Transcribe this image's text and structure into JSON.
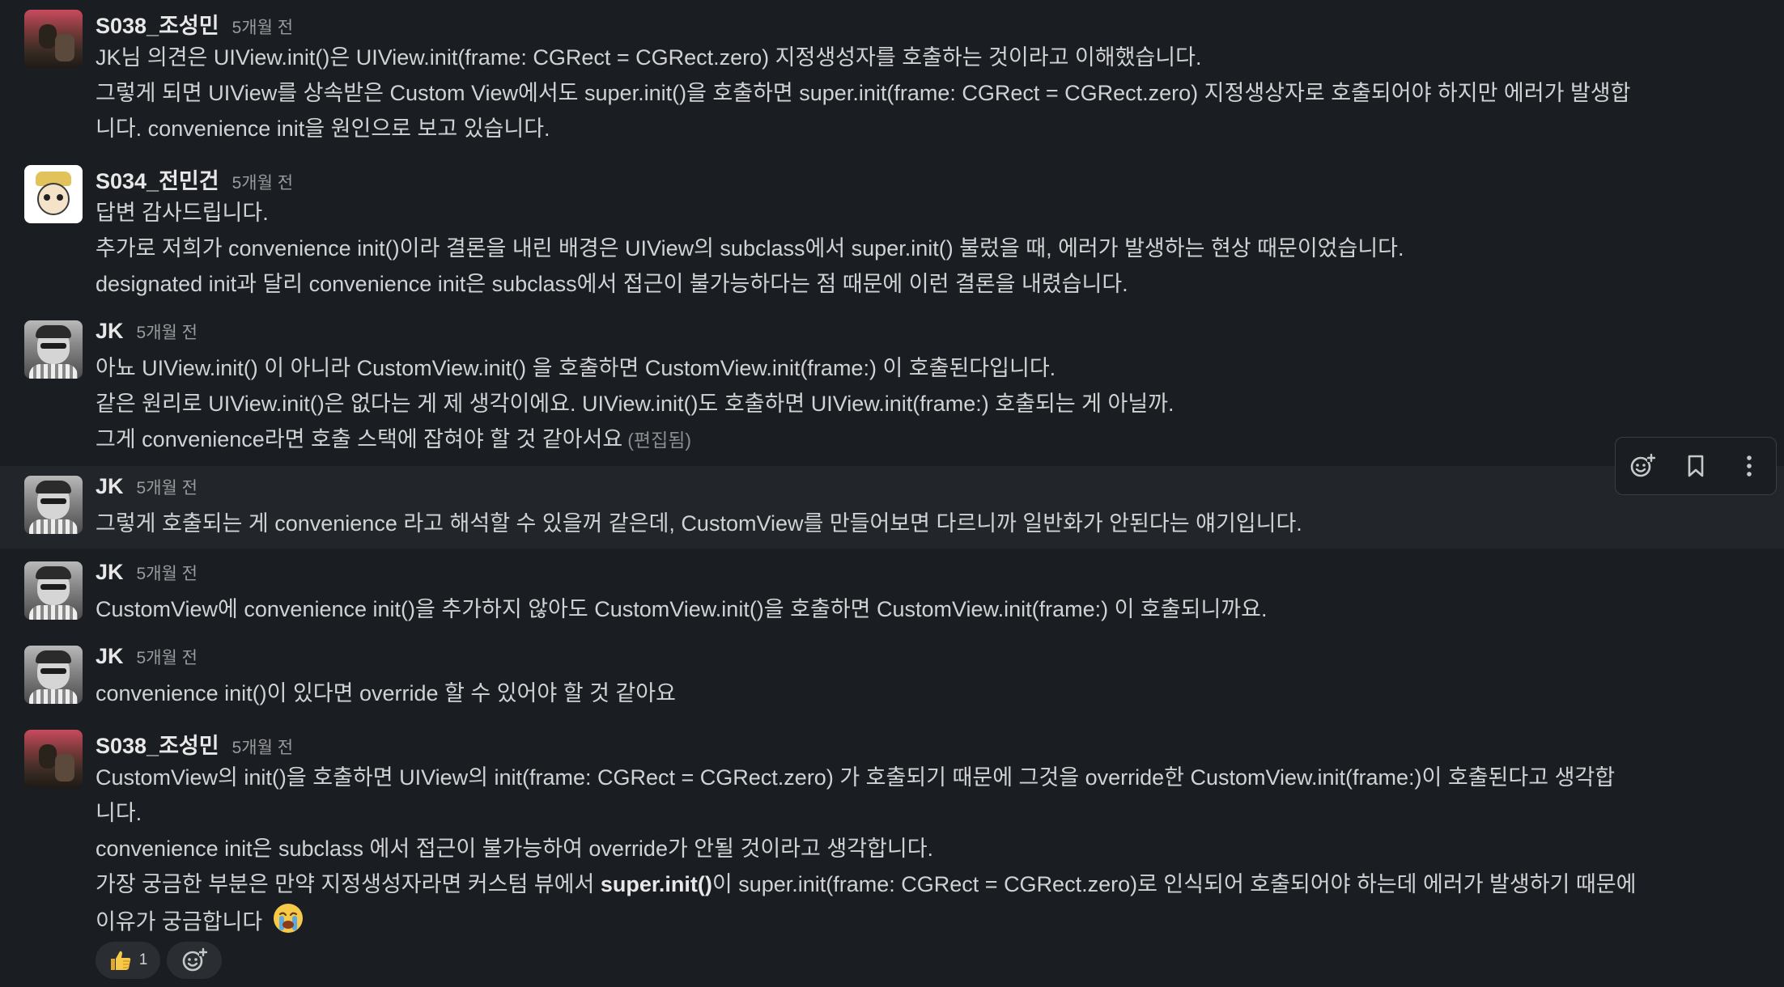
{
  "messages": [
    {
      "author": "S038_조성민",
      "time": "5개월 전",
      "lines": [
        "JK님 의견은 UIView.init()은 UIView.init(frame: CGRect = CGRect.zero) 지정생성자를 호출하는 것이라고 이해했습니다.",
        "그렇게 되면 UIView를 상속받은 Custom View에서도 super.init()을 호출하면 super.init(frame: CGRect = CGRect.zero) 지정생상자로 호출되어야 하지만 에러가 발생합",
        "니다. convenience init을 원인으로 보고 있습니다."
      ]
    },
    {
      "author": "S034_전민건",
      "time": "5개월 전",
      "lines": [
        "답변 감사드립니다.",
        "추가로 저희가 convenience init()이라 결론을 내린 배경은 UIView의 subclass에서 super.init() 불렀을 때, 에러가 발생하는 현상 때문이었습니다.",
        "designated init과 달리 convenience init은 subclass에서 접근이 불가능하다는 점 때문에 이런 결론을 내렸습니다."
      ]
    },
    {
      "author": "JK",
      "time": "5개월 전",
      "lines": [
        "아뇨 UIView.init() 이 아니라 CustomView.init() 을 호출하면 CustomView.init(frame:) 이 호출된다입니다.",
        "같은 원리로 UIView.init()은 없다는 게 제 생각이에요. UIView.init()도 호출하면 UIView.init(frame:) 호출되는 게 아닐까.",
        "그게 convenience라면 호출 스택에 잡혀야 할 것 같아서요"
      ],
      "edited": "(편집됨)"
    },
    {
      "author": "JK",
      "time": "5개월 전",
      "lines": [
        "그렇게 호출되는 게 convenience 라고 해석할 수 있을꺼 같은데, CustomView를 만들어보면 다르니까 일반화가 안된다는 얘기입니다."
      ]
    },
    {
      "author": "JK",
      "time": "5개월 전",
      "lines": [
        "CustomView에 convenience init()을 추가하지 않아도 CustomView.init()을 호출하면 CustomView.init(frame:) 이 호출되니까요."
      ]
    },
    {
      "author": "JK",
      "time": "5개월 전",
      "lines": [
        "convenience init()이 있다면 override 할 수 있어야 할 것 같아요"
      ]
    },
    {
      "author": "S038_조성민",
      "time": "5개월 전",
      "lines": [
        "CustomView의 init()을 호출하면 UIView의 init(frame: CGRect = CGRect.zero) 가 호출되기 때문에 그것을 override한 CustomView.init(frame:)이 호출된다고 생각합",
        "니다.",
        "convenience init은 subclass 에서 접근이 불가능하여 override가 안될 것이라고 생각합니다."
      ],
      "last_line_pre": "가장 궁금한 부분은 만약 지정생성자라면 커스텀 뷰에서 ",
      "last_line_bold": "super.init()",
      "last_line_post": "이 super.init(frame: CGRect = CGRect.zero)로 인식되어 호출되어야 하는데 에러가 발생하기 때문에",
      "final_line": "이유가 궁금합니다",
      "final_emoji": "crying-face-emoji"
    }
  ],
  "reactions": {
    "thumbs_up_count": "1",
    "thumbs_up_icon": "thumbs-up-emoji",
    "add_icon": "add-reaction-icon"
  },
  "toolbar": {
    "icons": [
      "add-reaction-icon",
      "bookmark-icon",
      "more-vertical-icon"
    ]
  },
  "colors": {
    "background": "#1a1d21",
    "hover_row": "#222529",
    "text": "#d1d2d3",
    "muted": "#9a9b9d"
  }
}
